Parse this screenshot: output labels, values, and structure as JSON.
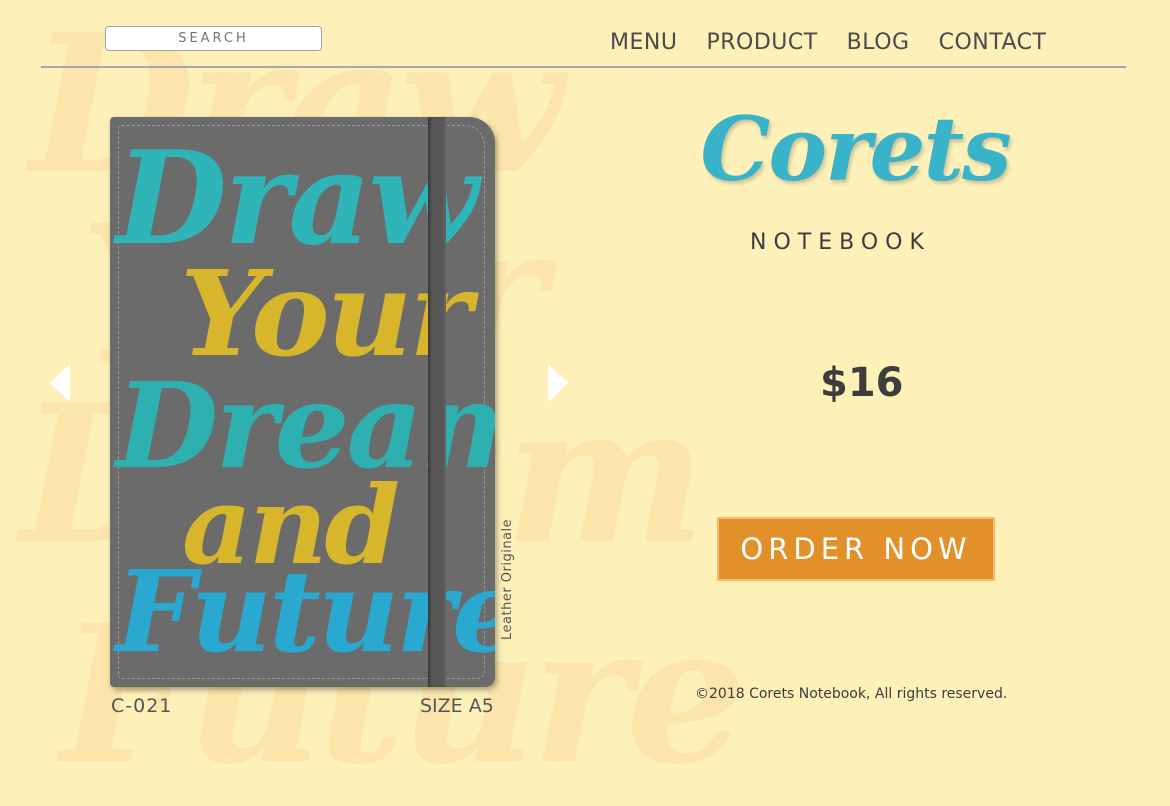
{
  "header": {
    "search_placeholder": "SEARCH",
    "nav": [
      "MENU",
      "PRODUCT",
      "BLOG",
      "CONTACT"
    ]
  },
  "product": {
    "cover_text": [
      "Draw",
      "Your",
      "Dream",
      "and",
      "Future"
    ],
    "side_label": "Leather Originale",
    "code": "C-021",
    "size": "SIZE A5",
    "brand": "Corets",
    "brand_sub": "NOTEBOOK",
    "price": "$16",
    "order_label": "ORDER NOW",
    "copyright": "©2018 Corets Notebook, All rights reserved."
  },
  "carousel": {
    "prev_icon": "chevron-left-icon",
    "next_icon": "chevron-right-icon"
  },
  "colors": {
    "background": "#fdf0b8",
    "accent_teal": "#38b3c9",
    "accent_yellow": "#d8b62c",
    "order_button": "#e2902a",
    "notebook_cover": "#6b6b6b"
  }
}
